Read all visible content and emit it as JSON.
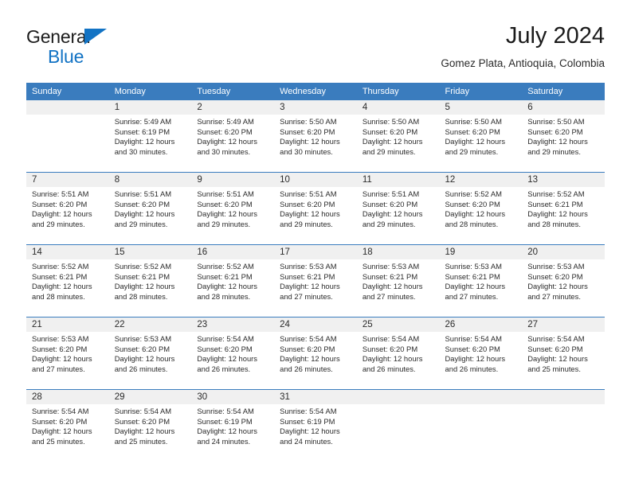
{
  "brand": {
    "name_part1": "General",
    "name_part2": "Blue",
    "accent_color": "#1273c4"
  },
  "header": {
    "title": "July 2024",
    "subtitle": "Gomez Plata, Antioquia, Colombia"
  },
  "calendar": {
    "header_bg": "#3a7cbe",
    "daynum_bg": "#f0f0f0",
    "weekday_headers": [
      "Sunday",
      "Monday",
      "Tuesday",
      "Wednesday",
      "Thursday",
      "Friday",
      "Saturday"
    ],
    "weeks": [
      [
        {
          "day": "",
          "sunrise": "",
          "sunset": "",
          "daylight_line1": "",
          "daylight_line2": ""
        },
        {
          "day": "1",
          "sunrise": "Sunrise: 5:49 AM",
          "sunset": "Sunset: 6:19 PM",
          "daylight_line1": "Daylight: 12 hours",
          "daylight_line2": "and 30 minutes."
        },
        {
          "day": "2",
          "sunrise": "Sunrise: 5:49 AM",
          "sunset": "Sunset: 6:20 PM",
          "daylight_line1": "Daylight: 12 hours",
          "daylight_line2": "and 30 minutes."
        },
        {
          "day": "3",
          "sunrise": "Sunrise: 5:50 AM",
          "sunset": "Sunset: 6:20 PM",
          "daylight_line1": "Daylight: 12 hours",
          "daylight_line2": "and 30 minutes."
        },
        {
          "day": "4",
          "sunrise": "Sunrise: 5:50 AM",
          "sunset": "Sunset: 6:20 PM",
          "daylight_line1": "Daylight: 12 hours",
          "daylight_line2": "and 29 minutes."
        },
        {
          "day": "5",
          "sunrise": "Sunrise: 5:50 AM",
          "sunset": "Sunset: 6:20 PM",
          "daylight_line1": "Daylight: 12 hours",
          "daylight_line2": "and 29 minutes."
        },
        {
          "day": "6",
          "sunrise": "Sunrise: 5:50 AM",
          "sunset": "Sunset: 6:20 PM",
          "daylight_line1": "Daylight: 12 hours",
          "daylight_line2": "and 29 minutes."
        }
      ],
      [
        {
          "day": "7",
          "sunrise": "Sunrise: 5:51 AM",
          "sunset": "Sunset: 6:20 PM",
          "daylight_line1": "Daylight: 12 hours",
          "daylight_line2": "and 29 minutes."
        },
        {
          "day": "8",
          "sunrise": "Sunrise: 5:51 AM",
          "sunset": "Sunset: 6:20 PM",
          "daylight_line1": "Daylight: 12 hours",
          "daylight_line2": "and 29 minutes."
        },
        {
          "day": "9",
          "sunrise": "Sunrise: 5:51 AM",
          "sunset": "Sunset: 6:20 PM",
          "daylight_line1": "Daylight: 12 hours",
          "daylight_line2": "and 29 minutes."
        },
        {
          "day": "10",
          "sunrise": "Sunrise: 5:51 AM",
          "sunset": "Sunset: 6:20 PM",
          "daylight_line1": "Daylight: 12 hours",
          "daylight_line2": "and 29 minutes."
        },
        {
          "day": "11",
          "sunrise": "Sunrise: 5:51 AM",
          "sunset": "Sunset: 6:20 PM",
          "daylight_line1": "Daylight: 12 hours",
          "daylight_line2": "and 29 minutes."
        },
        {
          "day": "12",
          "sunrise": "Sunrise: 5:52 AM",
          "sunset": "Sunset: 6:20 PM",
          "daylight_line1": "Daylight: 12 hours",
          "daylight_line2": "and 28 minutes."
        },
        {
          "day": "13",
          "sunrise": "Sunrise: 5:52 AM",
          "sunset": "Sunset: 6:21 PM",
          "daylight_line1": "Daylight: 12 hours",
          "daylight_line2": "and 28 minutes."
        }
      ],
      [
        {
          "day": "14",
          "sunrise": "Sunrise: 5:52 AM",
          "sunset": "Sunset: 6:21 PM",
          "daylight_line1": "Daylight: 12 hours",
          "daylight_line2": "and 28 minutes."
        },
        {
          "day": "15",
          "sunrise": "Sunrise: 5:52 AM",
          "sunset": "Sunset: 6:21 PM",
          "daylight_line1": "Daylight: 12 hours",
          "daylight_line2": "and 28 minutes."
        },
        {
          "day": "16",
          "sunrise": "Sunrise: 5:52 AM",
          "sunset": "Sunset: 6:21 PM",
          "daylight_line1": "Daylight: 12 hours",
          "daylight_line2": "and 28 minutes."
        },
        {
          "day": "17",
          "sunrise": "Sunrise: 5:53 AM",
          "sunset": "Sunset: 6:21 PM",
          "daylight_line1": "Daylight: 12 hours",
          "daylight_line2": "and 27 minutes."
        },
        {
          "day": "18",
          "sunrise": "Sunrise: 5:53 AM",
          "sunset": "Sunset: 6:21 PM",
          "daylight_line1": "Daylight: 12 hours",
          "daylight_line2": "and 27 minutes."
        },
        {
          "day": "19",
          "sunrise": "Sunrise: 5:53 AM",
          "sunset": "Sunset: 6:21 PM",
          "daylight_line1": "Daylight: 12 hours",
          "daylight_line2": "and 27 minutes."
        },
        {
          "day": "20",
          "sunrise": "Sunrise: 5:53 AM",
          "sunset": "Sunset: 6:20 PM",
          "daylight_line1": "Daylight: 12 hours",
          "daylight_line2": "and 27 minutes."
        }
      ],
      [
        {
          "day": "21",
          "sunrise": "Sunrise: 5:53 AM",
          "sunset": "Sunset: 6:20 PM",
          "daylight_line1": "Daylight: 12 hours",
          "daylight_line2": "and 27 minutes."
        },
        {
          "day": "22",
          "sunrise": "Sunrise: 5:53 AM",
          "sunset": "Sunset: 6:20 PM",
          "daylight_line1": "Daylight: 12 hours",
          "daylight_line2": "and 26 minutes."
        },
        {
          "day": "23",
          "sunrise": "Sunrise: 5:54 AM",
          "sunset": "Sunset: 6:20 PM",
          "daylight_line1": "Daylight: 12 hours",
          "daylight_line2": "and 26 minutes."
        },
        {
          "day": "24",
          "sunrise": "Sunrise: 5:54 AM",
          "sunset": "Sunset: 6:20 PM",
          "daylight_line1": "Daylight: 12 hours",
          "daylight_line2": "and 26 minutes."
        },
        {
          "day": "25",
          "sunrise": "Sunrise: 5:54 AM",
          "sunset": "Sunset: 6:20 PM",
          "daylight_line1": "Daylight: 12 hours",
          "daylight_line2": "and 26 minutes."
        },
        {
          "day": "26",
          "sunrise": "Sunrise: 5:54 AM",
          "sunset": "Sunset: 6:20 PM",
          "daylight_line1": "Daylight: 12 hours",
          "daylight_line2": "and 26 minutes."
        },
        {
          "day": "27",
          "sunrise": "Sunrise: 5:54 AM",
          "sunset": "Sunset: 6:20 PM",
          "daylight_line1": "Daylight: 12 hours",
          "daylight_line2": "and 25 minutes."
        }
      ],
      [
        {
          "day": "28",
          "sunrise": "Sunrise: 5:54 AM",
          "sunset": "Sunset: 6:20 PM",
          "daylight_line1": "Daylight: 12 hours",
          "daylight_line2": "and 25 minutes."
        },
        {
          "day": "29",
          "sunrise": "Sunrise: 5:54 AM",
          "sunset": "Sunset: 6:20 PM",
          "daylight_line1": "Daylight: 12 hours",
          "daylight_line2": "and 25 minutes."
        },
        {
          "day": "30",
          "sunrise": "Sunrise: 5:54 AM",
          "sunset": "Sunset: 6:19 PM",
          "daylight_line1": "Daylight: 12 hours",
          "daylight_line2": "and 24 minutes."
        },
        {
          "day": "31",
          "sunrise": "Sunrise: 5:54 AM",
          "sunset": "Sunset: 6:19 PM",
          "daylight_line1": "Daylight: 12 hours",
          "daylight_line2": "and 24 minutes."
        },
        {
          "day": "",
          "sunrise": "",
          "sunset": "",
          "daylight_line1": "",
          "daylight_line2": ""
        },
        {
          "day": "",
          "sunrise": "",
          "sunset": "",
          "daylight_line1": "",
          "daylight_line2": ""
        },
        {
          "day": "",
          "sunrise": "",
          "sunset": "",
          "daylight_line1": "",
          "daylight_line2": ""
        }
      ]
    ]
  }
}
